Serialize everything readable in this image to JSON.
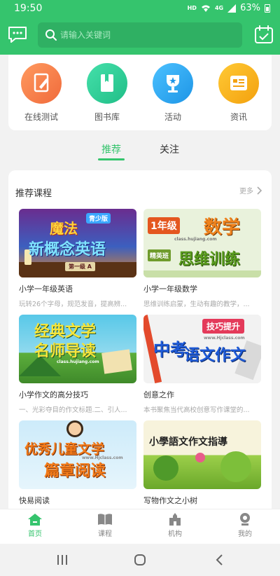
{
  "status_bar": {
    "time": "19:50",
    "network": "HD",
    "signal": "4G",
    "battery": "63%"
  },
  "header": {
    "search_placeholder": "请输入关键词"
  },
  "quick_entries": [
    {
      "label": "在线测试",
      "icon": "pencil-doc-icon",
      "color": "#f57c4d"
    },
    {
      "label": "图书库",
      "icon": "book-icon",
      "color": "#2fcf98"
    },
    {
      "label": "活动",
      "icon": "trophy-icon",
      "color": "#2fa7f0"
    },
    {
      "label": "资讯",
      "icon": "news-icon",
      "color": "#f5b51a"
    }
  ],
  "tabs": [
    {
      "label": "推荐",
      "active": true
    },
    {
      "label": "关注",
      "active": false
    }
  ],
  "courses_section": {
    "title": "推荐课程",
    "more": "更多",
    "items": [
      {
        "title": "小学一年级英语",
        "desc": "玩转26个字母，规范发音，提高辨...",
        "thumb": {
          "line1": "魔法",
          "line2": "新概念英语",
          "badge": "青少版",
          "sub": "第一级 A"
        }
      },
      {
        "title": "小学一年级数学",
        "desc": "思维训练启蒙，生动有趣的教学，...",
        "thumb": {
          "line1": "1年级",
          "line2": "数学",
          "line3": "思维训练",
          "tag": "精英班",
          "site": "class.hujiang.com"
        }
      },
      {
        "title": "小学作文的高分技巧",
        "desc": "一、光彩夺目的作文标题.二、引人...",
        "thumb": {
          "line1": "经典文学",
          "line2": "名师导读",
          "site": "class.hujiang.com"
        }
      },
      {
        "title": "创意之作",
        "desc": "本书聚焦当代高校创意写作课堂的...",
        "thumb": {
          "line1": "中考",
          "line2": "语文作文",
          "tag": "技巧提升",
          "site": "www.Hjclass.com"
        }
      },
      {
        "title": "快易阅读",
        "desc": "",
        "thumb": {
          "line1": "优秀儿童文学",
          "line2": "篇章阅读",
          "site": "www.Hjclass.com"
        }
      },
      {
        "title": "写物作文之小树",
        "desc": "",
        "thumb": {
          "line1": "小學語文作文指導"
        }
      }
    ]
  },
  "bottom_nav": [
    {
      "label": "首页",
      "icon": "home-icon",
      "active": true
    },
    {
      "label": "课程",
      "icon": "open-book-icon",
      "active": false
    },
    {
      "label": "机构",
      "icon": "building-icon",
      "active": false
    },
    {
      "label": "我的",
      "icon": "user-icon",
      "active": false
    }
  ],
  "colors": {
    "brand": "#35c46d",
    "background": "#f2f2f2"
  }
}
